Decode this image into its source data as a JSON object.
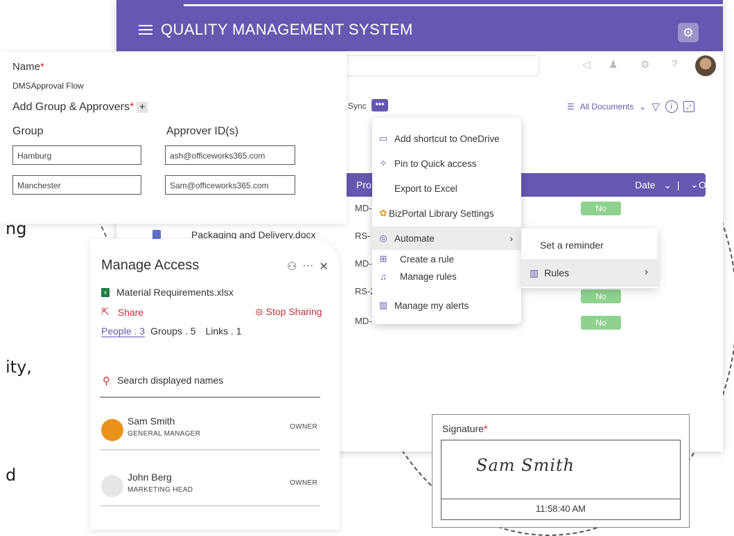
{
  "qms": {
    "title": "QUALITY MANAGEMENT SYSTEM",
    "sync_label": "Sync",
    "dots": "•••",
    "all_documents": "All Documents",
    "table": {
      "col_prod": "Pro",
      "col_date": "Date",
      "col_overdue": "Overdue",
      "rows": [
        {
          "prod": "MD-",
          "overdue": "No"
        },
        {
          "prod": "RS-",
          "overdue": ""
        },
        {
          "prod": "MD-",
          "overdue": ""
        },
        {
          "prod": "RS-2",
          "overdue": "No"
        },
        {
          "prod": "MD-",
          "overdue": "No"
        }
      ],
      "file_name": "Packaging and Delivery.docx"
    }
  },
  "menu": {
    "items": [
      {
        "label": "Add shortcut to OneDrive",
        "icon": "folder-icon"
      },
      {
        "label": "Pin to Quick access",
        "icon": "pin-icon"
      },
      {
        "label": "Export to Excel",
        "icon": ""
      },
      {
        "label": "BizPortal Library Settings",
        "icon": "bizportal-icon"
      },
      {
        "label": "Automate",
        "icon": "automate-icon"
      },
      {
        "label": "Create a rule",
        "icon": "rule-icon"
      },
      {
        "label": "Manage rules",
        "icon": "bell-icon"
      },
      {
        "label": "Manage my alerts",
        "icon": "alert-icon"
      }
    ],
    "submenu": [
      {
        "label": "Set a reminder"
      },
      {
        "label": "Rules"
      }
    ]
  },
  "form": {
    "name_label": "Name",
    "name_value": "DMSApproval Flow",
    "approvers_label": "Add Group & Approvers",
    "group_header": "Group",
    "approver_header": "Approver ID(s)",
    "rows": [
      {
        "group": "Hamburg",
        "approver": "ash@officeworks365.com"
      },
      {
        "group": "Manchester",
        "approver": "Sam@officeworks365.com"
      }
    ]
  },
  "manage_access": {
    "title": "Manage Access",
    "file": "Material Requirements.xlsx",
    "share": "Share",
    "stop_sharing": "Stop Sharing",
    "tabs": [
      "People . 3",
      "Groups . 5",
      "Links . 1"
    ],
    "search_placeholder": "Search displayed names",
    "people": [
      {
        "name": "Sam Smith",
        "role": "GENERAL MANAGER",
        "access": "OWNER",
        "color": "#e8921c"
      },
      {
        "name": "John Berg",
        "role": "MARKETING HEAD",
        "access": "OWNER",
        "color": "#e6e6e6"
      }
    ]
  },
  "signature": {
    "label": "Signature",
    "ink": "Sam Smith",
    "time": "11:58:40 AM"
  },
  "background_text": [
    "ng",
    "ity,",
    "d"
  ]
}
